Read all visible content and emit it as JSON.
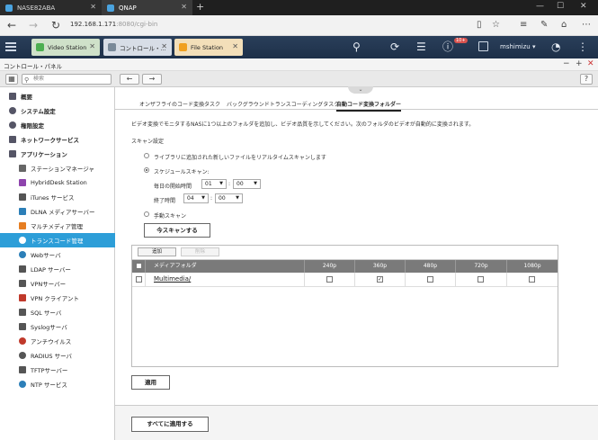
{
  "browser": {
    "tabs": [
      {
        "label": "NASE82ABA"
      },
      {
        "label": "QNAP"
      }
    ],
    "url": "192.168.1.171",
    "url_suffix": ":8080/cgi-bin"
  },
  "appbar": {
    "tabs": [
      {
        "label": "Video Station",
        "color": "#4caf50"
      },
      {
        "label": "コントロール・...",
        "color": "#7a8a9a"
      },
      {
        "label": "File Station",
        "color": "#f0a020"
      }
    ],
    "notification_count": "10+",
    "username": "mshimizu ▾"
  },
  "control_panel": {
    "title": "コントロール・パネル",
    "search_placeholder": "検索"
  },
  "sidebar": {
    "items": [
      {
        "label": "概要",
        "type": "section",
        "color": "#556"
      },
      {
        "label": "システム設定",
        "type": "section",
        "color": "#556"
      },
      {
        "label": "権限設定",
        "type": "section",
        "color": "#556"
      },
      {
        "label": "ネットワークサービス",
        "type": "section",
        "color": "#556"
      },
      {
        "label": "アプリケーション",
        "type": "section",
        "color": "#556"
      },
      {
        "label": "ステーションマネージャ",
        "type": "sub",
        "color": "#666"
      },
      {
        "label": "HybridDesk Station",
        "type": "sub",
        "color": "#8e44ad"
      },
      {
        "label": "iTunes サービス",
        "type": "sub",
        "color": "#555"
      },
      {
        "label": "DLNA メディアサーバー",
        "type": "sub",
        "color": "#2c7fb8"
      },
      {
        "label": "マルチメディア管理",
        "type": "sub",
        "color": "#e67e22"
      },
      {
        "label": "トランスコード管理",
        "type": "sub",
        "color": "#2d9ed8",
        "active": true
      },
      {
        "label": "Webサーバ",
        "type": "sub",
        "color": "#2c7fb8"
      },
      {
        "label": "LDAP サーバー",
        "type": "sub",
        "color": "#555"
      },
      {
        "label": "VPNサーバー",
        "type": "sub",
        "color": "#555"
      },
      {
        "label": "VPN クライアント",
        "type": "sub",
        "color": "#c0392b"
      },
      {
        "label": "SQL サーバ",
        "type": "sub",
        "color": "#555"
      },
      {
        "label": "Syslogサーバ",
        "type": "sub",
        "color": "#555"
      },
      {
        "label": "アンチウイルス",
        "type": "sub",
        "color": "#c0392b"
      },
      {
        "label": "RADIUS サーバ",
        "type": "sub",
        "color": "#555"
      },
      {
        "label": "TFTPサーバー",
        "type": "sub",
        "color": "#555"
      },
      {
        "label": "NTP サービス",
        "type": "sub",
        "color": "#2c7fb8"
      }
    ]
  },
  "main": {
    "subtabs": [
      {
        "label": "オンザフライのコード変換タスク"
      },
      {
        "label": "バックグラウンドトランスコーディングタスク"
      },
      {
        "label": "自動コード変換フォルダー"
      }
    ],
    "description": "ビデオ変換でモニタするNASに1つ以上のフォルダを追加し、ビデオ品質を示してください。次のフォルダのビデオが自動的に変換されます。",
    "scan_settings_label": "スキャン設定",
    "option_realtime": "ライブラリに追加された新しいファイルをリアルタイムスキャンします",
    "option_schedule": "スケジュールスキャン:",
    "daily_start_label": "毎日の開始時間",
    "start_hour": "01",
    "start_min": "00",
    "end_label": "終了時間",
    "end_hour": "04",
    "end_min": "00",
    "colon": ":",
    "option_manual": "手動スキャン",
    "scan_now_button": "今スキャンする",
    "add_button": "追加",
    "delete_button": "削除",
    "table": {
      "headers": [
        "メディアフォルダ",
        "240p",
        "360p",
        "480p",
        "720p",
        "1080p"
      ],
      "rows": [
        {
          "folder": "Multimedia/",
          "checks": [
            false,
            true,
            false,
            false,
            false
          ]
        }
      ]
    },
    "apply_button": "適用",
    "apply_all_button": "すべてに適用する"
  }
}
